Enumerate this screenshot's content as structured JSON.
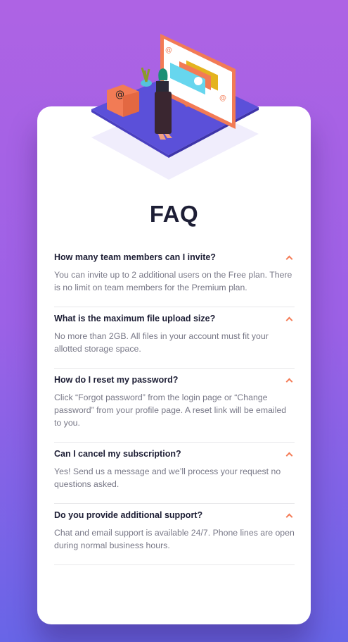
{
  "title": "FAQ",
  "accent_color": "#f47c57",
  "faqs": [
    {
      "question": "How many team members can I invite?",
      "answer": "You can invite up to 2 additional users on the Free plan. There is no limit on team members for the Premium plan.",
      "expanded": true
    },
    {
      "question": "What is the maximum file upload size?",
      "answer": "No more than 2GB. All files in your account must fit your allotted storage space.",
      "expanded": true
    },
    {
      "question": "How do I reset my password?",
      "answer": "Click “Forgot password” from the login page or “Change password” from your profile page. A reset link will be emailed to you.",
      "expanded": true
    },
    {
      "question": "Can I cancel my subscription?",
      "answer": "Yes! Send us a message and we’ll process your request no questions asked.",
      "expanded": true
    },
    {
      "question": "Do you provide additional support?",
      "answer": "Chat and email support is available 24/7. Phone lines are open during normal business hours.",
      "expanded": true
    }
  ]
}
